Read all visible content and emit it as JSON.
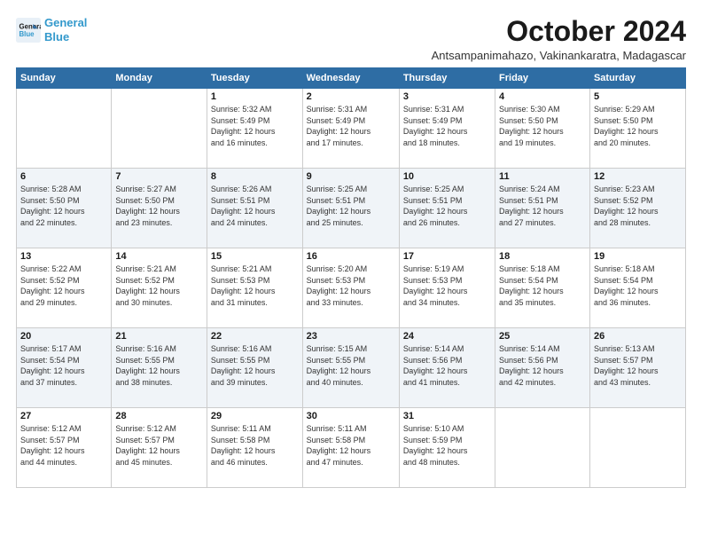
{
  "logo": {
    "line1": "General",
    "line2": "Blue"
  },
  "title": "October 2024",
  "subtitle": "Antsampanimahazo, Vakinankaratra, Madagascar",
  "weekdays": [
    "Sunday",
    "Monday",
    "Tuesday",
    "Wednesday",
    "Thursday",
    "Friday",
    "Saturday"
  ],
  "weeks": [
    [
      {
        "day": "",
        "info": ""
      },
      {
        "day": "",
        "info": ""
      },
      {
        "day": "1",
        "info": "Sunrise: 5:32 AM\nSunset: 5:49 PM\nDaylight: 12 hours\nand 16 minutes."
      },
      {
        "day": "2",
        "info": "Sunrise: 5:31 AM\nSunset: 5:49 PM\nDaylight: 12 hours\nand 17 minutes."
      },
      {
        "day": "3",
        "info": "Sunrise: 5:31 AM\nSunset: 5:49 PM\nDaylight: 12 hours\nand 18 minutes."
      },
      {
        "day": "4",
        "info": "Sunrise: 5:30 AM\nSunset: 5:50 PM\nDaylight: 12 hours\nand 19 minutes."
      },
      {
        "day": "5",
        "info": "Sunrise: 5:29 AM\nSunset: 5:50 PM\nDaylight: 12 hours\nand 20 minutes."
      }
    ],
    [
      {
        "day": "6",
        "info": "Sunrise: 5:28 AM\nSunset: 5:50 PM\nDaylight: 12 hours\nand 22 minutes."
      },
      {
        "day": "7",
        "info": "Sunrise: 5:27 AM\nSunset: 5:50 PM\nDaylight: 12 hours\nand 23 minutes."
      },
      {
        "day": "8",
        "info": "Sunrise: 5:26 AM\nSunset: 5:51 PM\nDaylight: 12 hours\nand 24 minutes."
      },
      {
        "day": "9",
        "info": "Sunrise: 5:25 AM\nSunset: 5:51 PM\nDaylight: 12 hours\nand 25 minutes."
      },
      {
        "day": "10",
        "info": "Sunrise: 5:25 AM\nSunset: 5:51 PM\nDaylight: 12 hours\nand 26 minutes."
      },
      {
        "day": "11",
        "info": "Sunrise: 5:24 AM\nSunset: 5:51 PM\nDaylight: 12 hours\nand 27 minutes."
      },
      {
        "day": "12",
        "info": "Sunrise: 5:23 AM\nSunset: 5:52 PM\nDaylight: 12 hours\nand 28 minutes."
      }
    ],
    [
      {
        "day": "13",
        "info": "Sunrise: 5:22 AM\nSunset: 5:52 PM\nDaylight: 12 hours\nand 29 minutes."
      },
      {
        "day": "14",
        "info": "Sunrise: 5:21 AM\nSunset: 5:52 PM\nDaylight: 12 hours\nand 30 minutes."
      },
      {
        "day": "15",
        "info": "Sunrise: 5:21 AM\nSunset: 5:53 PM\nDaylight: 12 hours\nand 31 minutes."
      },
      {
        "day": "16",
        "info": "Sunrise: 5:20 AM\nSunset: 5:53 PM\nDaylight: 12 hours\nand 33 minutes."
      },
      {
        "day": "17",
        "info": "Sunrise: 5:19 AM\nSunset: 5:53 PM\nDaylight: 12 hours\nand 34 minutes."
      },
      {
        "day": "18",
        "info": "Sunrise: 5:18 AM\nSunset: 5:54 PM\nDaylight: 12 hours\nand 35 minutes."
      },
      {
        "day": "19",
        "info": "Sunrise: 5:18 AM\nSunset: 5:54 PM\nDaylight: 12 hours\nand 36 minutes."
      }
    ],
    [
      {
        "day": "20",
        "info": "Sunrise: 5:17 AM\nSunset: 5:54 PM\nDaylight: 12 hours\nand 37 minutes."
      },
      {
        "day": "21",
        "info": "Sunrise: 5:16 AM\nSunset: 5:55 PM\nDaylight: 12 hours\nand 38 minutes."
      },
      {
        "day": "22",
        "info": "Sunrise: 5:16 AM\nSunset: 5:55 PM\nDaylight: 12 hours\nand 39 minutes."
      },
      {
        "day": "23",
        "info": "Sunrise: 5:15 AM\nSunset: 5:55 PM\nDaylight: 12 hours\nand 40 minutes."
      },
      {
        "day": "24",
        "info": "Sunrise: 5:14 AM\nSunset: 5:56 PM\nDaylight: 12 hours\nand 41 minutes."
      },
      {
        "day": "25",
        "info": "Sunrise: 5:14 AM\nSunset: 5:56 PM\nDaylight: 12 hours\nand 42 minutes."
      },
      {
        "day": "26",
        "info": "Sunrise: 5:13 AM\nSunset: 5:57 PM\nDaylight: 12 hours\nand 43 minutes."
      }
    ],
    [
      {
        "day": "27",
        "info": "Sunrise: 5:12 AM\nSunset: 5:57 PM\nDaylight: 12 hours\nand 44 minutes."
      },
      {
        "day": "28",
        "info": "Sunrise: 5:12 AM\nSunset: 5:57 PM\nDaylight: 12 hours\nand 45 minutes."
      },
      {
        "day": "29",
        "info": "Sunrise: 5:11 AM\nSunset: 5:58 PM\nDaylight: 12 hours\nand 46 minutes."
      },
      {
        "day": "30",
        "info": "Sunrise: 5:11 AM\nSunset: 5:58 PM\nDaylight: 12 hours\nand 47 minutes."
      },
      {
        "day": "31",
        "info": "Sunrise: 5:10 AM\nSunset: 5:59 PM\nDaylight: 12 hours\nand 48 minutes."
      },
      {
        "day": "",
        "info": ""
      },
      {
        "day": "",
        "info": ""
      }
    ]
  ]
}
